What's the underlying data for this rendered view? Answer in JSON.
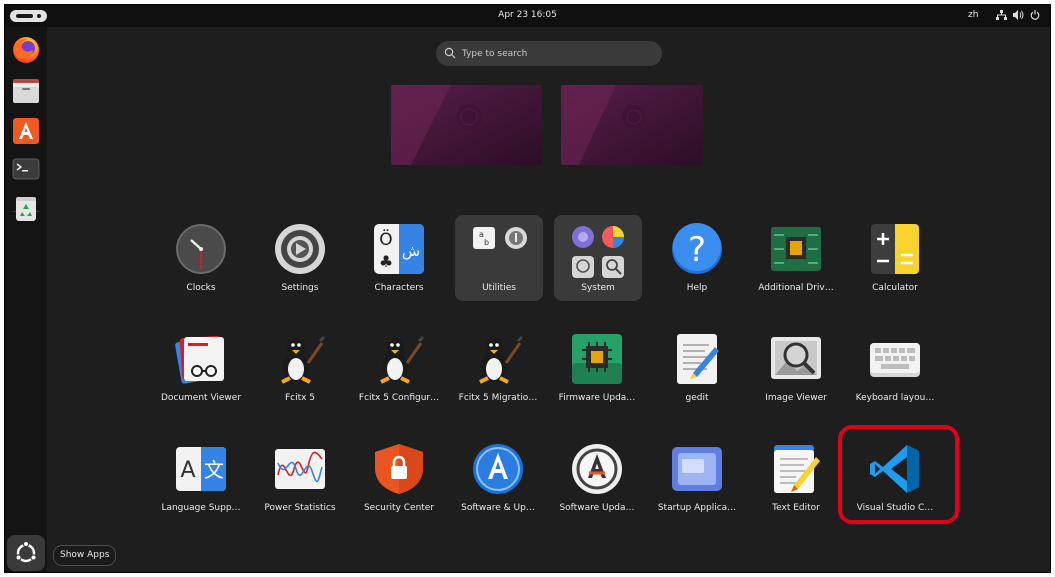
{
  "topbar": {
    "clock": "Apr 23  16:05",
    "input_method": "zh",
    "icons": [
      "network-icon",
      "volume-icon",
      "power-icon"
    ]
  },
  "dock": {
    "items": [
      "firefox-icon",
      "files-icon",
      "app-center-icon",
      "terminal-icon",
      "trash-icon"
    ],
    "show_apps_tooltip": "Show Apps"
  },
  "search": {
    "placeholder": "Type to search"
  },
  "apps": {
    "row1": [
      {
        "label": "Clocks",
        "icon": "clocks-icon"
      },
      {
        "label": "Settings",
        "icon": "settings-icon"
      },
      {
        "label": "Characters",
        "icon": "characters-icon"
      },
      {
        "label": "Utilities",
        "icon": "utilities-folder-icon"
      },
      {
        "label": "System",
        "icon": "system-folder-icon"
      },
      {
        "label": "Help",
        "icon": "help-icon"
      },
      {
        "label": "Additional Driv…",
        "icon": "additional-drivers-icon"
      },
      {
        "label": "Calculator",
        "icon": "calculator-icon"
      }
    ],
    "row2": [
      {
        "label": "Document Viewer",
        "icon": "document-viewer-icon"
      },
      {
        "label": "Fcitx 5",
        "icon": "fcitx-icon"
      },
      {
        "label": "Fcitx 5 Configur…",
        "icon": "fcitx-config-icon"
      },
      {
        "label": "Fcitx 5 Migratio…",
        "icon": "fcitx-migration-icon"
      },
      {
        "label": "Firmware Upda…",
        "icon": "firmware-updater-icon"
      },
      {
        "label": "gedit",
        "icon": "gedit-icon"
      },
      {
        "label": "Image Viewer",
        "icon": "image-viewer-icon"
      },
      {
        "label": "Keyboard layou…",
        "icon": "keyboard-layout-icon"
      }
    ],
    "row3": [
      {
        "label": "Language Supp…",
        "icon": "language-support-icon"
      },
      {
        "label": "Power Statistics",
        "icon": "power-statistics-icon"
      },
      {
        "label": "Security Center",
        "icon": "security-center-icon"
      },
      {
        "label": "Software & Up…",
        "icon": "software-updates-icon"
      },
      {
        "label": "Software Upda…",
        "icon": "software-updater-icon"
      },
      {
        "label": "Startup Applica…",
        "icon": "startup-applications-icon"
      },
      {
        "label": "Text Editor",
        "icon": "text-editor-icon"
      },
      {
        "label": "Visual Studio C…",
        "icon": "vscode-icon"
      }
    ]
  },
  "highlight": {
    "target": "Visual Studio C…",
    "color": "#e4001b"
  }
}
